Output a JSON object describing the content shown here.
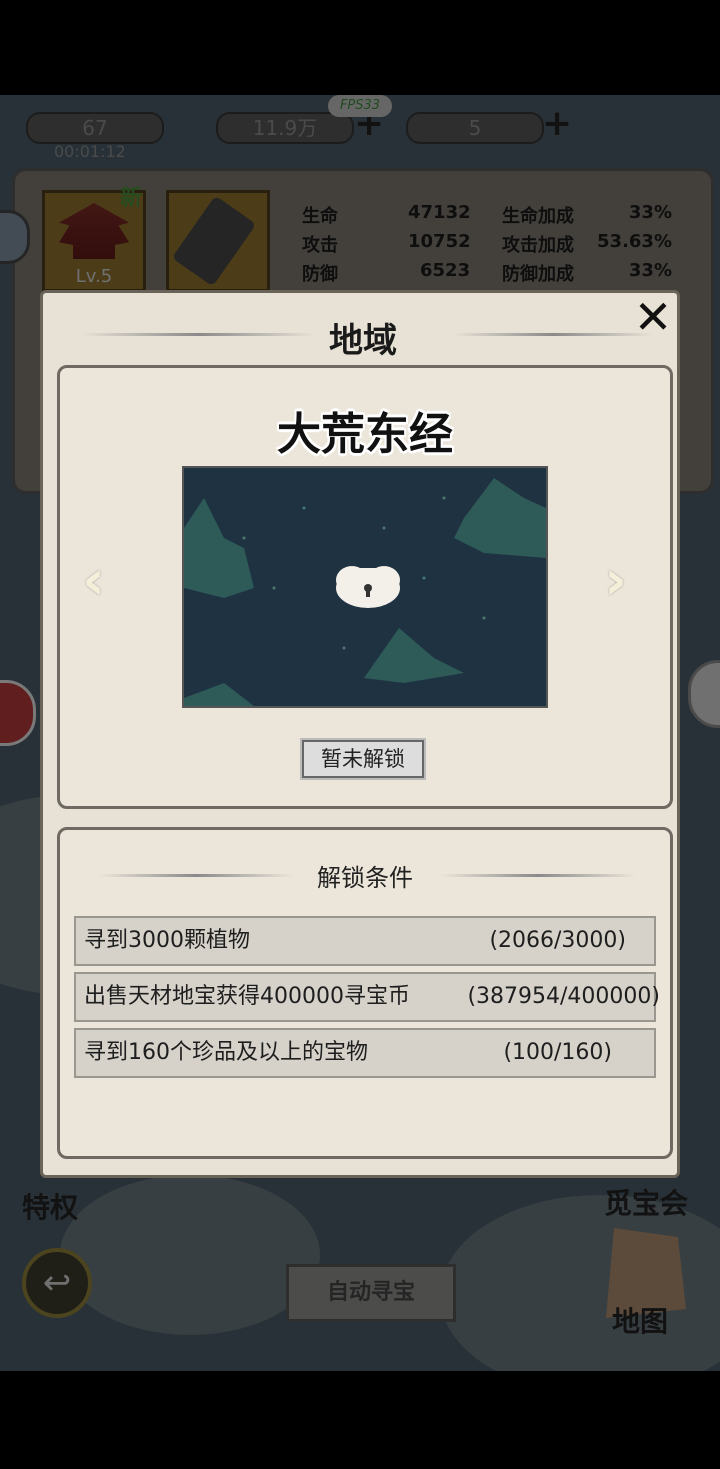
{
  "top_bar": {
    "energy": "67",
    "timer": "00:01:12",
    "coins": "11.9万",
    "gems": "5",
    "fps": "FPS33",
    "plus_symbol": "+"
  },
  "character": {
    "level": "Lv.5",
    "new_tag": "新"
  },
  "stats": [
    {
      "label": "生命",
      "value": "47132",
      "bonus_label": "生命加成",
      "bonus_value": "33%"
    },
    {
      "label": "攻击",
      "value": "10752",
      "bonus_label": "攻击加成",
      "bonus_value": "53.63%"
    },
    {
      "label": "防御",
      "value": "6523",
      "bonus_label": "防御加成",
      "bonus_value": "33%"
    }
  ],
  "bottom": {
    "privilege": "特权",
    "treasure_meet": "觅宝会",
    "auto_search": "自动寻宝",
    "map": "地图",
    "back_icon": "↩"
  },
  "modal": {
    "title": "地域",
    "close_icon": "✕",
    "region_name": "大荒东经",
    "prev_arrow": "‹",
    "next_arrow": "›",
    "lock_status": "暂未解锁",
    "conditions_title": "解锁条件",
    "conditions": [
      {
        "text": "寻到3000颗植物",
        "progress": "(2066/3000)"
      },
      {
        "text": "出售天材地宝获得400000寻宝币",
        "progress": "(387954/400000)"
      },
      {
        "text": "寻到160个珍品及以上的宝物",
        "progress": "(100/160)"
      }
    ]
  }
}
